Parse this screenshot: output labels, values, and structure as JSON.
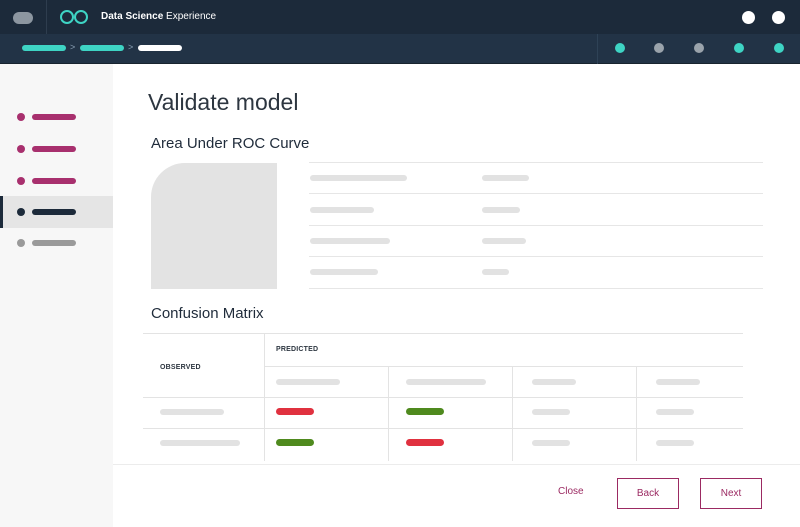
{
  "header": {
    "app_title_bold": "Data Science",
    "app_title_rest": " Experience",
    "menu_icon": "menu-toggle-icon",
    "logo_icon": "infinity-logo-icon",
    "right_icons": [
      "user-circle-icon",
      "help-circle-icon"
    ]
  },
  "breadcrumb": {
    "separators": [
      ">",
      ">"
    ],
    "colors": {
      "past": "#3ed4c4",
      "current": "#ffffff"
    }
  },
  "steps": {
    "colors": [
      "#3ed4c4",
      "#9aa3ab",
      "#9aa3ab",
      "#3ed4c4",
      "#3ed4c4"
    ]
  },
  "sidebar": {
    "colors": {
      "complete": "#a8306e",
      "active": "#1c2a3a",
      "pending": "#9a9a9a"
    }
  },
  "main": {
    "page_title": "Validate model",
    "roc_section_title": "Area Under ROC Curve",
    "confusion_section_title": "Confusion Matrix",
    "matrix": {
      "observed_label": "OBSERVED",
      "predicted_label": "PREDICTED",
      "colors": {
        "correct": "#4f8a1e",
        "incorrect": "#e0313f"
      }
    }
  },
  "footer": {
    "close_label": "Close",
    "back_label": "Back",
    "next_label": "Next",
    "accent": "#9b2a62"
  }
}
